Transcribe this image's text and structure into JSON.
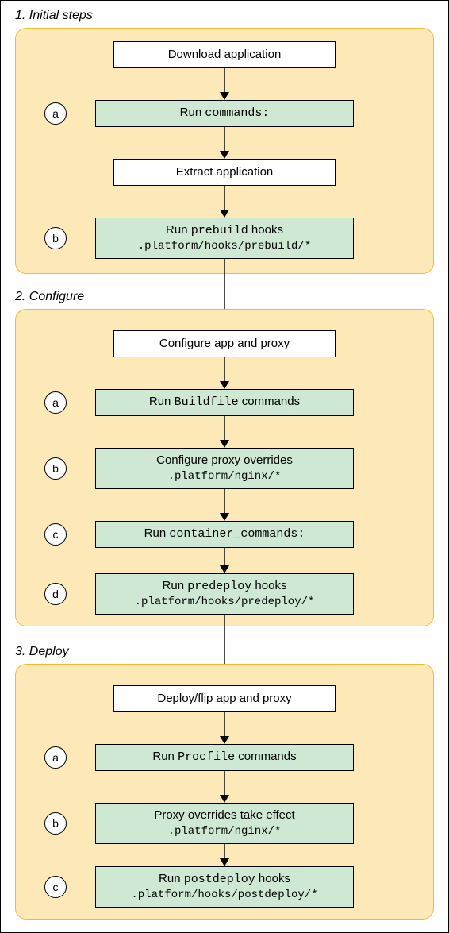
{
  "sections": {
    "s1": {
      "title": "1. Initial steps"
    },
    "s2": {
      "title": "2. Configure"
    },
    "s3": {
      "title": "3. Deploy"
    }
  },
  "boxes": {
    "s1_b0": {
      "line1": "Download application"
    },
    "s1_ba": {
      "letter": "a",
      "line1_pre": "Run ",
      "line1_mono": "commands:"
    },
    "s1_b1": {
      "line1": "Extract application"
    },
    "s1_bb": {
      "letter": "b",
      "line1_pre": "Run ",
      "line1_mono": "prebuild",
      "line1_post": " hooks",
      "line2": ".platform/hooks/prebuild/*"
    },
    "s2_b0": {
      "line1": "Configure app and proxy"
    },
    "s2_ba": {
      "letter": "a",
      "line1_pre": "Run ",
      "line1_mono": "Buildfile",
      "line1_post": " commands"
    },
    "s2_bb": {
      "letter": "b",
      "line1": "Configure proxy overrides",
      "line2": ".platform/nginx/*"
    },
    "s2_bc": {
      "letter": "c",
      "line1_pre": "Run ",
      "line1_mono": "container_commands:"
    },
    "s2_bd": {
      "letter": "d",
      "line1_pre": "Run ",
      "line1_mono": "predeploy",
      "line1_post": " hooks",
      "line2": ".platform/hooks/predeploy/*"
    },
    "s3_b0": {
      "line1": "Deploy/flip app and proxy"
    },
    "s3_ba": {
      "letter": "a",
      "line1_pre": "Run ",
      "line1_mono": "Procfile",
      "line1_post": " commands"
    },
    "s3_bb": {
      "letter": "b",
      "line1": "Proxy overrides take effect",
      "line2": ".platform/nginx/*"
    },
    "s3_bc": {
      "letter": "c",
      "line1_pre": "Run ",
      "line1_mono": "postdeploy",
      "line1_post": " hooks",
      "line2": ".platform/hooks/postdeploy/*"
    }
  }
}
